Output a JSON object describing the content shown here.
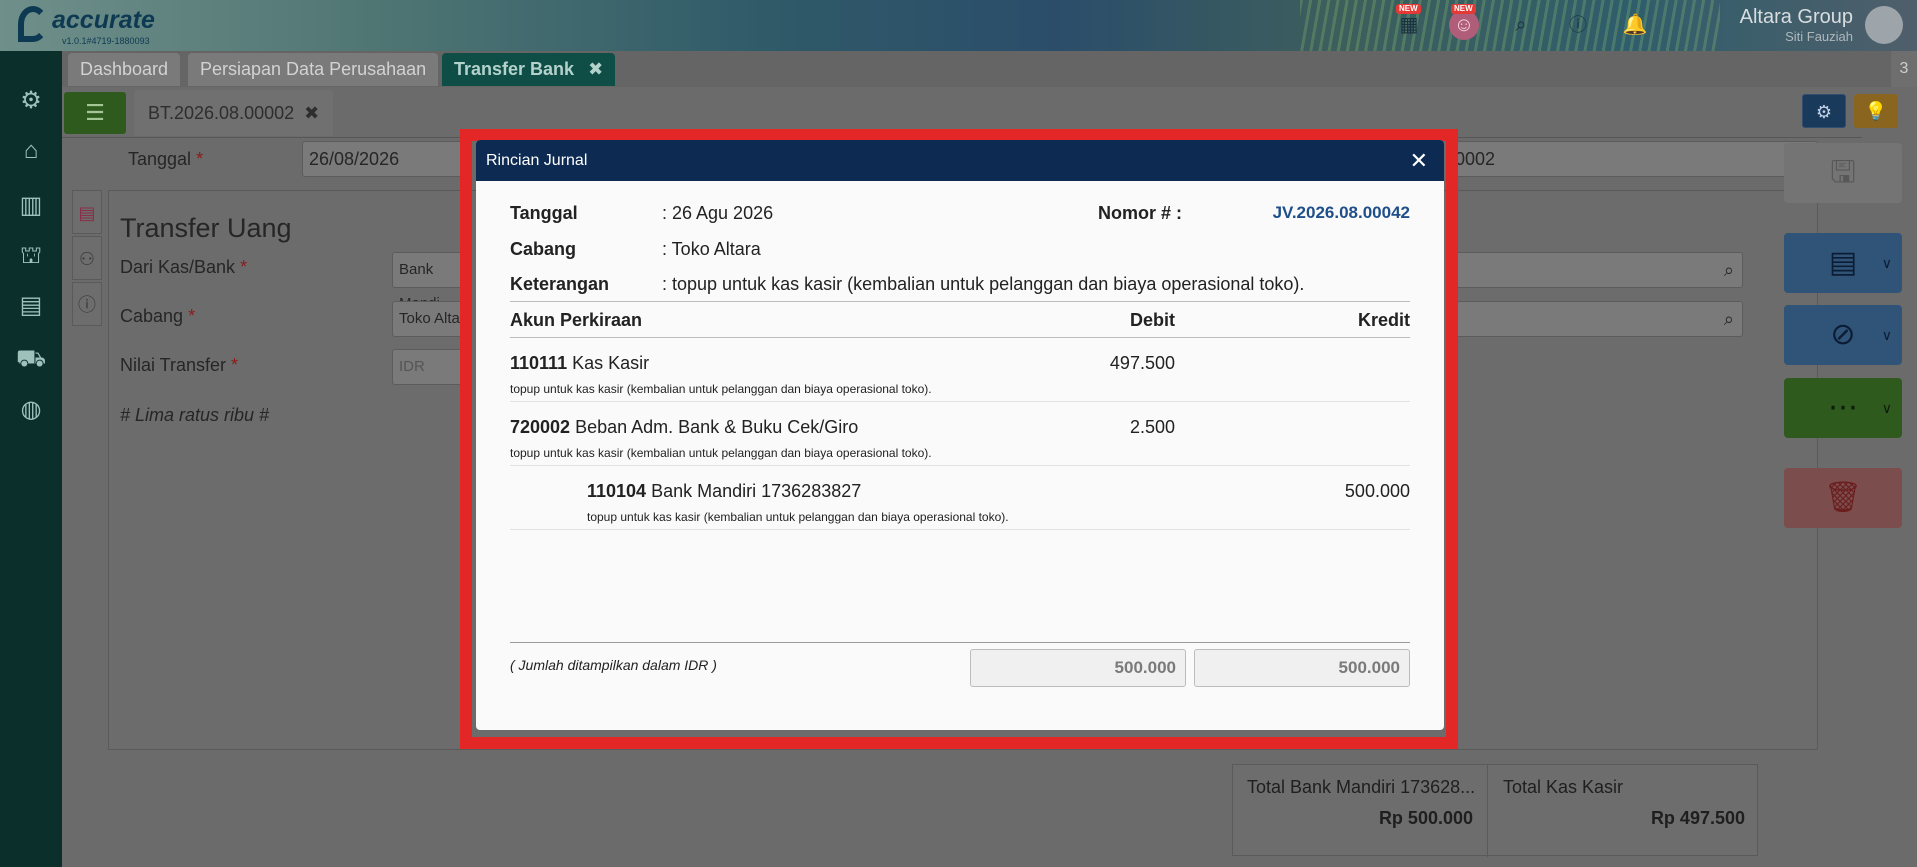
{
  "app": {
    "logo_name": "accurate",
    "logo_version": "v1.0.1#4719-1880093",
    "new_badge": "NEW",
    "company": "Altara Group",
    "user": "Siti Fauziah"
  },
  "tabs": [
    {
      "label": "Dashboard"
    },
    {
      "label": "Persiapan Data Perusahaan"
    },
    {
      "label": "Transfer Bank",
      "close": "✖"
    }
  ],
  "tab_count": "3",
  "doc_tab": {
    "label": "BT.2026.08.00002",
    "close": "✖"
  },
  "form": {
    "tanggal_label": "Tanggal",
    "tanggal_value": "26/08/2026",
    "nomor_value": "0002",
    "required_mark": "*",
    "title": "Transfer Uang",
    "dari_label": "Dari Kas/Bank",
    "dari_value": "Bank Mandi",
    "cabang_label": "Cabang",
    "cabang_value": "Toko Alta",
    "nilai_label": "Nilai Transfer",
    "nilai_placeholder": "IDR",
    "terbilang": "# Lima ratus ribu #"
  },
  "totals": [
    {
      "label": "Total Bank Mandiri 173628...",
      "value": "Rp 500.000"
    },
    {
      "label": "Total Kas Kasir",
      "value": "Rp 497.500"
    }
  ],
  "modal": {
    "title": "Rincian Jurnal",
    "close": "✕",
    "tanggal_label": "Tanggal",
    "tanggal_value": ": 26 Agu 2026",
    "nomor_label": "Nomor # :",
    "nomor_value": "JV.2026.08.00042",
    "cabang_label": "Cabang",
    "cabang_value": ": Toko Altara",
    "keterangan_label": "Keterangan",
    "keterangan_value": ": topup untuk kas kasir (kembalian untuk pelanggan dan biaya operasional toko).",
    "columns": {
      "akun": "Akun Perkiraan",
      "debit": "Debit",
      "kredit": "Kredit"
    },
    "rows": [
      {
        "code": "110111",
        "name": "Kas Kasir",
        "desc": "topup untuk kas kasir (kembalian untuk pelanggan dan biaya operasional toko).",
        "debit": "497.500",
        "kredit": ""
      },
      {
        "code": "720002",
        "name": "Beban Adm. Bank & Buku Cek/Giro",
        "desc": "topup untuk kas kasir (kembalian untuk pelanggan dan biaya operasional toko).",
        "debit": "2.500",
        "kredit": ""
      },
      {
        "code": "110104",
        "name": "Bank Mandiri 1736283827",
        "desc": "topup untuk kas kasir (kembalian untuk pelanggan dan biaya operasional toko).",
        "debit": "",
        "kredit": "500.000"
      }
    ],
    "footer_note": "( Jumlah ditampilkan dalam IDR )",
    "total_debit": "500.000",
    "total_kredit": "500.000"
  }
}
